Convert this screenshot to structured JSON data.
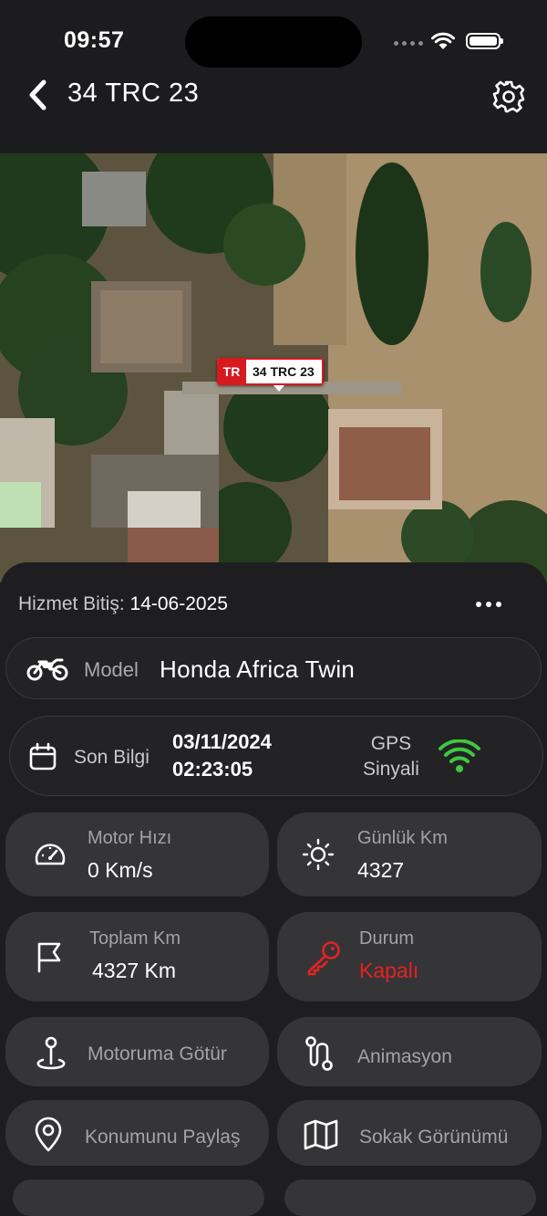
{
  "status_bar": {
    "time": "09:57"
  },
  "header": {
    "title": "34 TRC 23"
  },
  "map": {
    "marker_flag": "TR",
    "marker_plate": "34 TRC 23"
  },
  "panel": {
    "service_label": "Hizmet Bitiş:",
    "service_date": "14-06-2025",
    "model": {
      "label": "Model",
      "value": "Honda Africa Twin",
      "icon": "motorcycle-icon"
    },
    "last_info": {
      "label": "Son Bilgi",
      "date": "03/11/2024",
      "time": "02:23:05",
      "gps_line1": "GPS",
      "gps_line2": "Sinyali",
      "gps_color": "#3fc83f"
    },
    "tiles": [
      {
        "label": "Motor Hızı",
        "value": "0 Km/s",
        "icon": "speedometer-icon"
      },
      {
        "label": "Günlük Km",
        "value": "4327",
        "icon": "sun-icon"
      },
      {
        "label": "Toplam Km",
        "value": "4327 Km",
        "icon": "flag-icon"
      },
      {
        "label": "Durum",
        "value": "Kapalı",
        "icon": "key-icon",
        "value_color": "#e52222"
      }
    ],
    "actions": [
      {
        "label": "Motoruma Götür",
        "icon": "location-pin-icon"
      },
      {
        "label": "Animasyon",
        "icon": "route-icon"
      },
      {
        "label": "Konumunu Paylaş",
        "icon": "map-pin-icon"
      },
      {
        "label": "Sokak Görünümü",
        "icon": "map-icon"
      }
    ]
  }
}
